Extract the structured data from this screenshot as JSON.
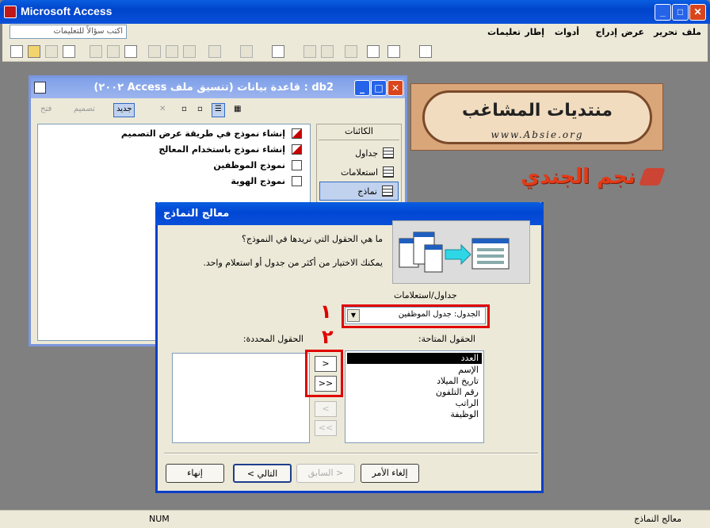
{
  "app": {
    "title": "Microsoft Access",
    "minimize": "_",
    "maximize": "□",
    "close": "✕"
  },
  "menu": [
    "ملف",
    "تحرير",
    "عرض",
    "إدراج",
    "أدوات",
    "إطار",
    "تعليمات"
  ],
  "help_box": {
    "placeholder": "اكتب سؤالاً للتعليمات"
  },
  "status": {
    "left": "معالج النماذج",
    "num": "NUM"
  },
  "db_window": {
    "title": "db2 : قاعدة بيانات (تنسيق ملف Access ٢٠٠٢)",
    "toolbar": {
      "open": "فتح",
      "design": "تصميم",
      "new": "جديد"
    },
    "items": [
      {
        "label": "إنشاء نموذج في طريقة عرض التصميم",
        "icon": "wizard-icon"
      },
      {
        "label": "إنشاء نموذج باستخدام المعالج",
        "icon": "wizard-icon"
      },
      {
        "label": "نموذج الموظفين",
        "icon": "form-icon"
      },
      {
        "label": "نموذج الهوية",
        "icon": "form-icon"
      }
    ],
    "objects_header": "الكائنات",
    "objects": [
      {
        "label": "جداول",
        "icon": "table-icon"
      },
      {
        "label": "استعلامات",
        "icon": "query-icon"
      },
      {
        "label": "نماذج",
        "icon": "form-icon"
      }
    ]
  },
  "banner": {
    "title": "منتديات المشاغب",
    "url": "www.Absie.org"
  },
  "signature": "نجم الجندي",
  "wizard": {
    "title": "معالج النماذج",
    "question": "ما هي الحقول التي تريدها في النموذج؟",
    "hint": "يمكنك الاختيار من أكثر من جدول أو استعلام واحد.",
    "tables_label": "جداول/استعلامات",
    "table_value": "الجدول: جدول الموظفين",
    "available_label": "الحقول المتاحة:",
    "selected_label": "الحقول المحددة:",
    "available_fields": [
      "العدد",
      "الإسم",
      "تاريخ الميلاد",
      "رقم التلفون",
      "الراتب",
      "الوظيفة"
    ],
    "move_buttons": [
      ">",
      ">>",
      "<",
      "<<"
    ],
    "buttons": {
      "cancel": "إلغاء الأمر",
      "back": "< السابق",
      "next": "التالي >",
      "finish": "إنهاء"
    },
    "annotations": {
      "one": "١",
      "two": "٢"
    }
  }
}
